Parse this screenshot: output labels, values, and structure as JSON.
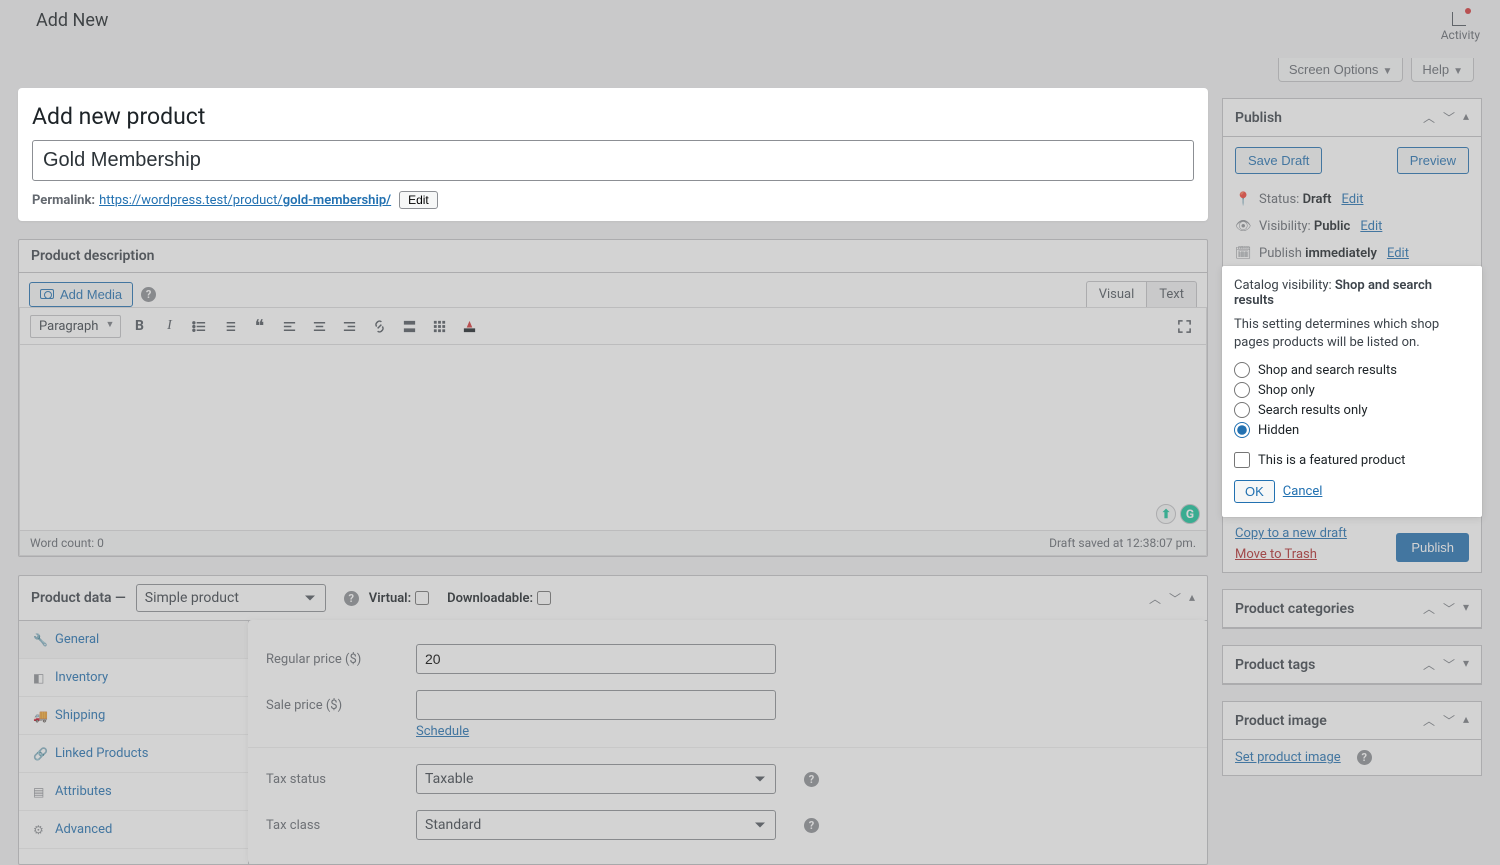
{
  "header": {
    "add_new": "Add New",
    "activity": "Activity",
    "screen_options": "Screen Options",
    "help": "Help"
  },
  "title_card": {
    "heading": "Add new product",
    "product_name": "Gold Membership",
    "permalink_label": "Permalink:",
    "permalink_base": "https://wordpress.test/product/",
    "permalink_slug": "gold-membership/",
    "edit": "Edit"
  },
  "editor": {
    "box_title": "Product description",
    "add_media": "Add Media",
    "tab_visual": "Visual",
    "tab_text": "Text",
    "format": "Paragraph",
    "word_count_label": "Word count: 0",
    "draft_saved": "Draft saved at 12:38:07 pm."
  },
  "product_data": {
    "title": "Product data —",
    "type": "Simple product",
    "virtual_label": "Virtual:",
    "download_label": "Downloadable:",
    "tabs": [
      "General",
      "Inventory",
      "Shipping",
      "Linked Products",
      "Attributes",
      "Advanced"
    ],
    "regular_price_label": "Regular price ($)",
    "regular_price": "20",
    "sale_price_label": "Sale price ($)",
    "sale_price": "",
    "schedule": "Schedule",
    "tax_status_label": "Tax status",
    "tax_status": "Taxable",
    "tax_class_label": "Tax class",
    "tax_class": "Standard"
  },
  "publish": {
    "title": "Publish",
    "save_draft": "Save Draft",
    "preview": "Preview",
    "status_label": "Status:",
    "status_value": "Draft",
    "visibility_label": "Visibility:",
    "visibility_value": "Public",
    "publish_label": "Publish",
    "publish_value": "immediately",
    "edit": "Edit",
    "catalog_label": "Catalog visibility:",
    "catalog_value": "Shop and search results",
    "catalog_desc": "This setting determines which shop pages products will be listed on.",
    "opts": [
      "Shop and search results",
      "Shop only",
      "Search results only",
      "Hidden"
    ],
    "selected_opt": "Hidden",
    "featured": "This is a featured product",
    "ok": "OK",
    "cancel": "Cancel",
    "copy": "Copy to a new draft",
    "trash": "Move to Trash",
    "publish_btn": "Publish"
  },
  "side_boxes": {
    "categories": "Product categories",
    "tags": "Product tags",
    "image": "Product image",
    "set_image": "Set product image"
  }
}
